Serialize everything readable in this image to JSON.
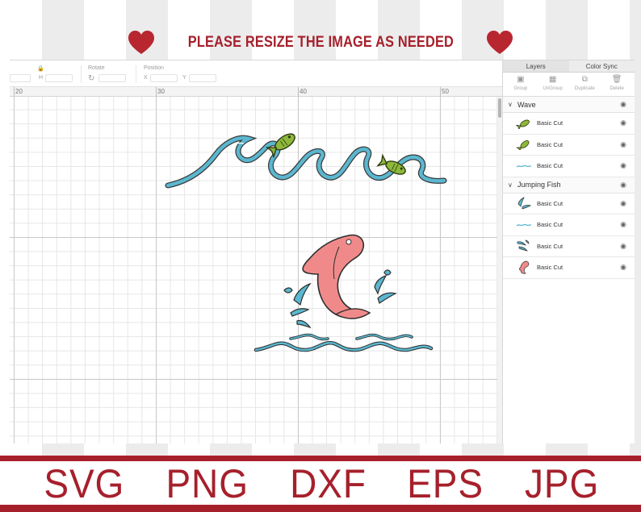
{
  "banner": {
    "text": "PLEASE RESIZE THE IMAGE AS NEEDED",
    "left_icon": "heart-icon",
    "right_icon": "heart-icon",
    "color": "#a6202c"
  },
  "toolbar": {
    "w_label": "W",
    "h_label": "H",
    "rotate_label": "Rotate",
    "position_label": "Position",
    "x_label": "X",
    "y_label": "Y"
  },
  "ruler": {
    "numbers": [
      "20",
      "30",
      "40",
      "50"
    ]
  },
  "panel": {
    "tabs": [
      "Layers",
      "Color Sync"
    ],
    "actions": [
      {
        "label": "Group",
        "icon": "group-icon"
      },
      {
        "label": "UnGroup",
        "icon": "ungroup-icon"
      },
      {
        "label": "Duplicate",
        "icon": "duplicate-icon"
      },
      {
        "label": "Delete",
        "icon": "trash-icon"
      }
    ],
    "groups": [
      {
        "name": "Wave",
        "layers": [
          {
            "label": "Basic Cut",
            "thumb": "fish-green"
          },
          {
            "label": "Basic Cut",
            "thumb": "fish-green"
          },
          {
            "label": "Basic Cut",
            "thumb": "wave-blue"
          }
        ]
      },
      {
        "name": "Jumping Fish",
        "layers": [
          {
            "label": "Basic Cut",
            "thumb": "splash-blue"
          },
          {
            "label": "Basic Cut",
            "thumb": "wave-blue"
          },
          {
            "label": "Basic Cut",
            "thumb": "splash-blue"
          },
          {
            "label": "Basic Cut",
            "thumb": "fish-pink"
          }
        ]
      }
    ]
  },
  "colors": {
    "wave": "#5bb7cf",
    "fish_green": "#8db83a",
    "fish_pink": "#f08a8a",
    "brand_red": "#a6202c"
  },
  "formats": [
    "SVG",
    "PNG",
    "DXF",
    "EPS",
    "JPG"
  ]
}
